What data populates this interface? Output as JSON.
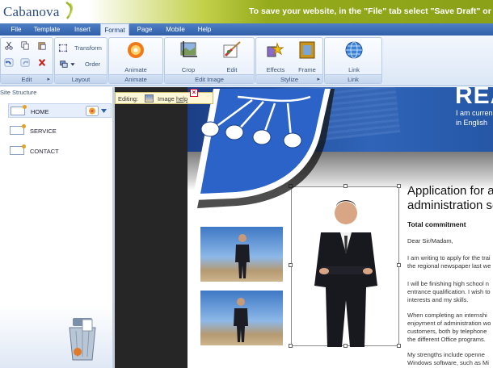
{
  "app": {
    "name": "Cabanova",
    "banner_message": "To save your website, in the \"File\" tab select \"Save Draft\" or \"Pu"
  },
  "menu": {
    "tabs": [
      "File",
      "Template",
      "Insert",
      "Format",
      "Page",
      "Mobile",
      "Help"
    ],
    "active": "Format"
  },
  "ribbon": {
    "groups": {
      "edit": "Edit",
      "layout": "Layout",
      "animate": "Animate",
      "edit_image": "Edit Image",
      "stylize": "Stylize",
      "link": "Link"
    },
    "buttons": {
      "transform": "Transform",
      "order": "Order",
      "animate": "Animate",
      "crop": "Crop",
      "edit": "Edit",
      "effects": "Effects",
      "frame": "Frame",
      "link": "Link"
    }
  },
  "sidebar": {
    "title": "Site Structure",
    "pages": [
      {
        "label": "HOME",
        "selected": true
      },
      {
        "label": "SERVICE",
        "selected": false
      },
      {
        "label": "CONTACT",
        "selected": false
      }
    ]
  },
  "editing_badge": {
    "label": "Editing:",
    "image_label": "Image",
    "help_link": "help"
  },
  "site": {
    "header_big": "REA",
    "header_line1": "I am curren",
    "header_line2": "in English",
    "letter": {
      "title_line1": "Application for a",
      "title_line2": "administration se",
      "subtitle": "Total commitment",
      "greeting": "Dear Sir/Madam,",
      "p1_l1": "I am writing to apply for the trai",
      "p1_l2": "the regional newspaper last we",
      "p2_l1": "I will be finishing high school n",
      "p2_l2": "entrance qualification. I wish to",
      "p2_l3": "interests and my skills.",
      "p3_l1": "When completing an internshi",
      "p3_l2": "enjoyment of administration wo",
      "p3_l3": "customers, both by telephone",
      "p3_l4": "the different Office programs.",
      "p4_l1": "My strengths include openne",
      "p4_l2": "Windows software, such as Mi"
    }
  },
  "colors": {
    "brand_blue": "#2d4f86",
    "banner_green": "#96ab1c",
    "menu_blue": "#2f5fa8",
    "site_header_blue": "#2557a6"
  }
}
